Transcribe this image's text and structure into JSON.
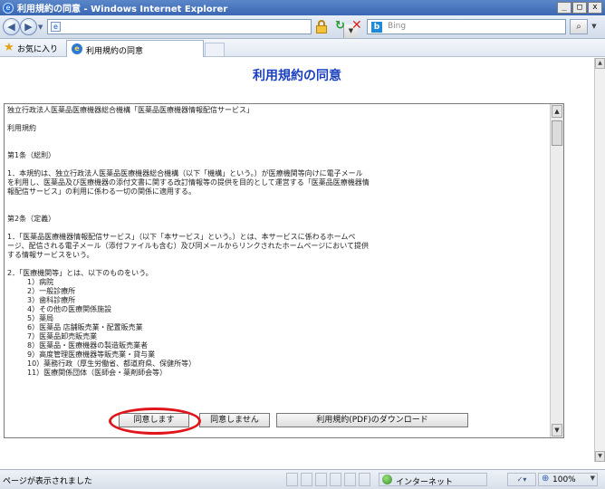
{
  "window": {
    "title": "利用規約の同意 - Windows Internet Explorer",
    "controls": {
      "minimize": "_",
      "maximize": "□",
      "close": "x"
    }
  },
  "addressbar": {
    "url": "",
    "search_placeholder": "Bing",
    "search_icon_label": "b"
  },
  "favorites": {
    "label": "お気に入り",
    "tab_label": "利用規約の同意"
  },
  "page": {
    "title": "利用規約の同意",
    "terms_lines": [
      "独立行政法人医薬品医療機器総合機構「医薬品医療機器情報配信サービス」",
      "",
      "利用規約",
      "",
      "",
      "第1条（総則）",
      "",
      "1．本規約は、独立行政法人医薬品医療機器総合機構（以下「機構」という。）が医療機関等向けに電子メール",
      "を利用し、医薬品及び医療機器の添付文書に関する改訂情報等の提供を目的として運営する「医薬品医療機器情",
      "報配信サービス」の利用に係わる一切の関係に適用する。",
      "",
      "",
      "第2条（定義）",
      "",
      "1．「医薬品医療機器情報配信サービス」（以下「本サービス」という。）とは、本サービスに係わるホームペ",
      "ージ、配信される電子メール（添付ファイルも含む）及び同メールからリンクされたホームページにおいて提供",
      "する情報サービスをいう。",
      "",
      "2．「医療機関等」とは、以下のものをいう。"
    ],
    "terms_items": [
      "1）病院",
      "2）一般診療所",
      "3）歯科診療所",
      "4）その他の医療関係施設",
      "5）薬局",
      "6）医薬品 店舗販売業・配置販売業",
      "7）医薬品卸売販売業",
      "8）医薬品・医療機器の製造販売業者",
      "9）高度管理医療機器等販売業・貸与業",
      "10）薬務行政（厚生労働省、都道府県、保健所等）",
      "11）医療関係団体（医師会・薬剤師会等）"
    ],
    "buttons": {
      "agree": "同意します",
      "disagree": "同意しません",
      "download": "利用規約(PDF)のダウンロード"
    }
  },
  "statusbar": {
    "text": "ページが表示されました",
    "zone": "インターネット",
    "protected_mode": "✓▾",
    "zoom": "100%"
  },
  "colors": {
    "title_blue": "#1a3fbf",
    "highlight_red": "#e0141b"
  }
}
